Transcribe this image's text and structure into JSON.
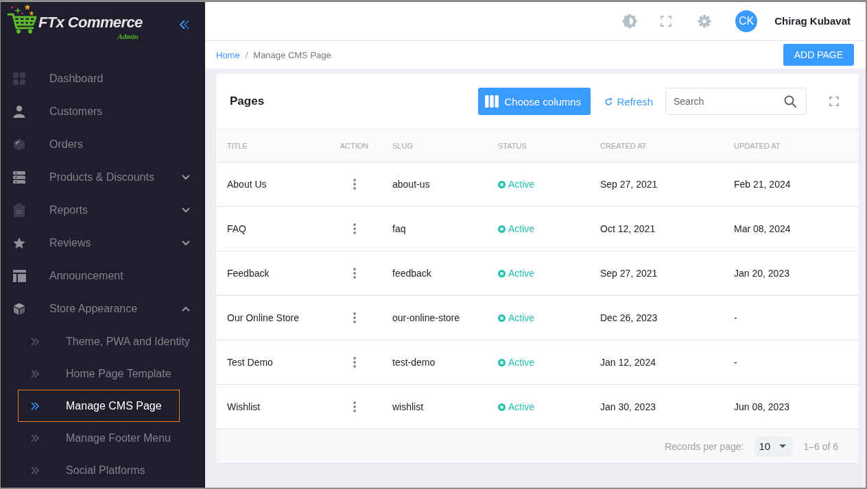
{
  "sidebar": {
    "logo": {
      "title": "FTx Commerce",
      "subtitle": "Admin"
    },
    "items": [
      {
        "kind": "link",
        "label": "Dashboard",
        "selected": false
      },
      {
        "kind": "link",
        "label": "Customers",
        "selected": false
      },
      {
        "kind": "link",
        "label": "Orders",
        "selected": false
      },
      {
        "kind": "group",
        "label": "Products & Discounts",
        "selected": false,
        "expanded": false
      },
      {
        "kind": "group",
        "label": "Reports",
        "selected": false,
        "expanded": false
      },
      {
        "kind": "group",
        "label": "Reviews",
        "selected": false,
        "expanded": false
      },
      {
        "kind": "link",
        "label": "Announcement",
        "selected": false
      },
      {
        "kind": "group",
        "label": "Store Appearance",
        "selected": false,
        "expanded": true,
        "children": [
          {
            "label": "Theme, PWA and Identity",
            "selected": false
          },
          {
            "label": "Home Page Template",
            "selected": false
          },
          {
            "label": "Manage CMS Page",
            "selected": true
          },
          {
            "label": "Manage Footer Menu",
            "selected": false
          },
          {
            "label": "Social Platforms",
            "selected": false
          }
        ]
      }
    ]
  },
  "header": {
    "avatar": "CK",
    "user_name": "Chirag Kubavat"
  },
  "page_bar": {
    "breadcrumb": [
      "Home",
      "Manage CMS Page"
    ],
    "separator": "/",
    "add_button": "ADD PAGE"
  },
  "card": {
    "title": "Pages",
    "choose_columns": "Choose columns",
    "refresh": "Refresh",
    "search": {
      "placeholder": "Search"
    },
    "table": {
      "columns": [
        "TITLE",
        "ACTION",
        "SLUG",
        "STATUS",
        "CREATED AT",
        "UPDATED AT"
      ],
      "rows": [
        {
          "title": "About Us",
          "slug": "about-us",
          "status": "Active",
          "created_at": "Sep 27, 2021",
          "updated_at": "Feb 21, 2024"
        },
        {
          "title": "FAQ",
          "slug": "faq",
          "status": "Active",
          "created_at": "Oct 12, 2021",
          "updated_at": "Mar 08, 2024"
        },
        {
          "title": "Feedback",
          "slug": "feedback",
          "status": "Active",
          "created_at": "Sep 27, 2021",
          "updated_at": "Jan 20, 2023"
        },
        {
          "title": "Our Online Store",
          "slug": "our-online-store",
          "status": "Active",
          "created_at": "Dec 26, 2023",
          "updated_at": "-"
        },
        {
          "title": "Test Demo",
          "slug": "test-demo",
          "status": "Active",
          "created_at": "Jan 12, 2024",
          "updated_at": "-"
        },
        {
          "title": "Wishlist",
          "slug": "wishlist",
          "status": "Active",
          "created_at": "Jan 30, 2023",
          "updated_at": "Jun 08, 2023"
        }
      ]
    },
    "pagination": {
      "label": "Records per page:",
      "per_page": "10",
      "range": "1–6 of 6"
    }
  }
}
